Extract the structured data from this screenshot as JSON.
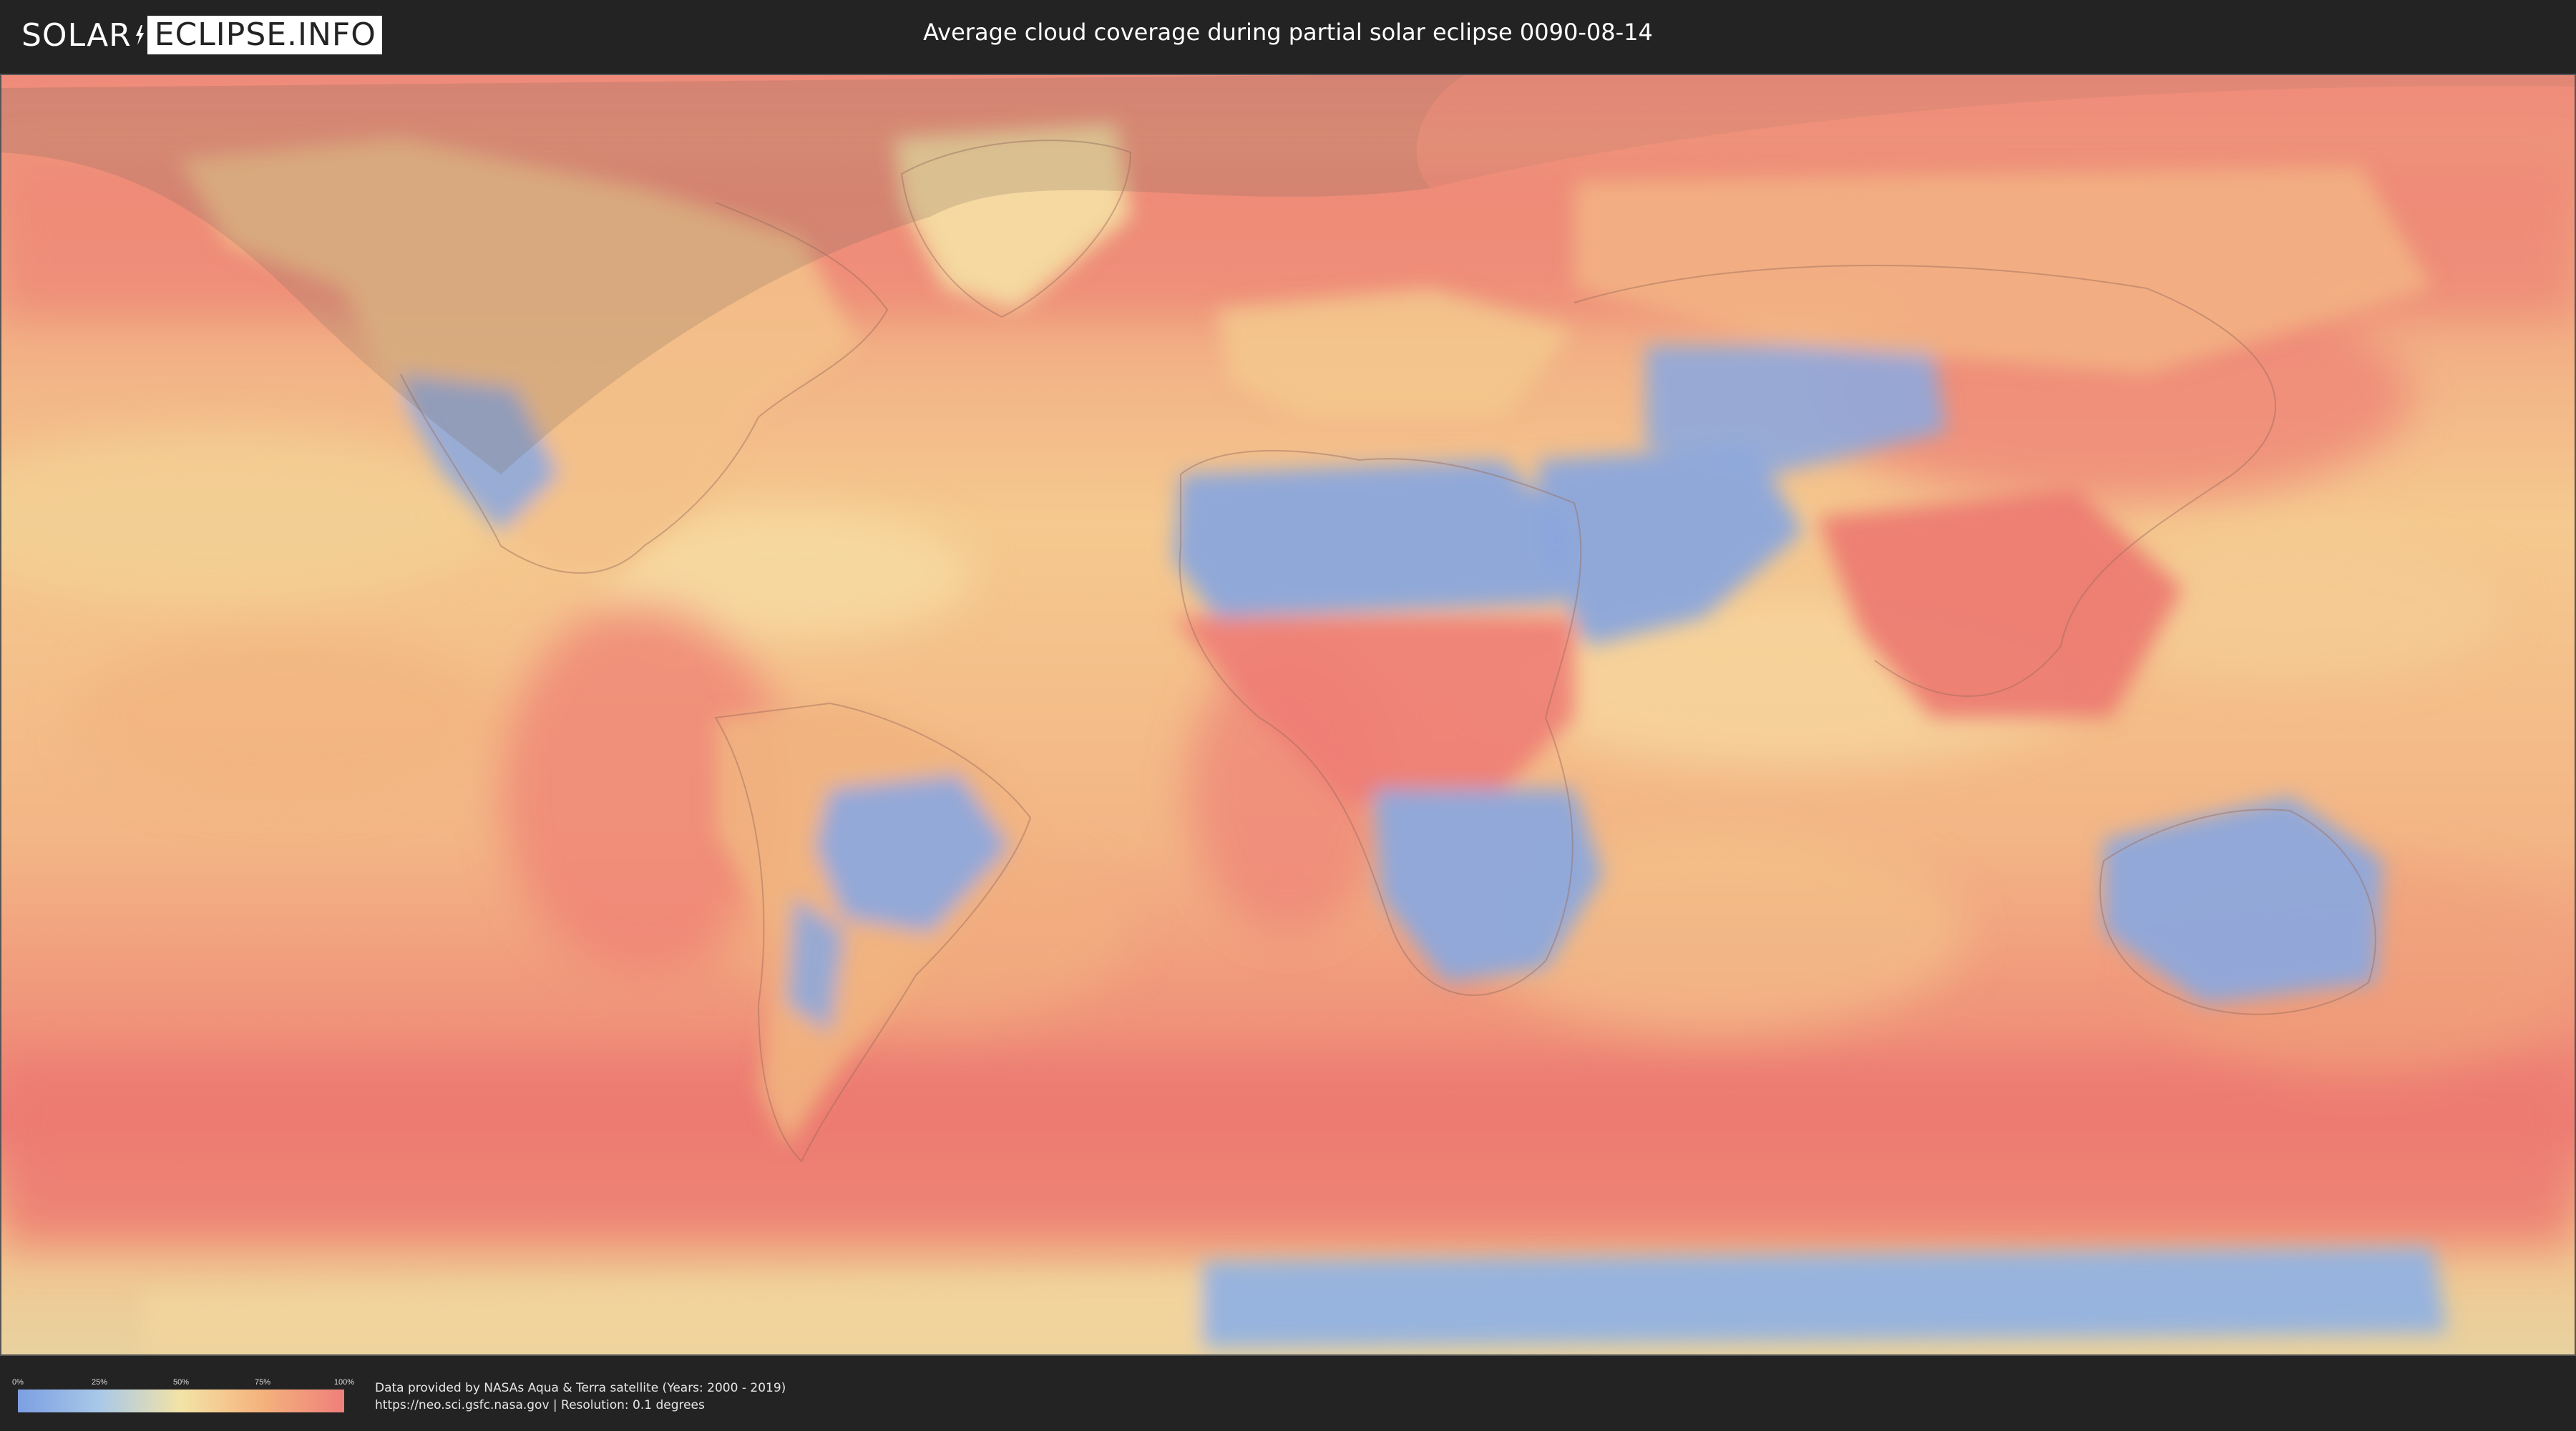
{
  "header": {
    "logo_left": "SOLAR",
    "logo_right": "ECLIPSE.INFO",
    "title": "Average cloud coverage during partial solar eclipse 0090-08-14"
  },
  "legend": {
    "ticks": [
      "0%",
      "25%",
      "50%",
      "75%",
      "100%"
    ],
    "tick_values": [
      0,
      25,
      50,
      75,
      100
    ],
    "colors": [
      "#7c9fe2",
      "#a9c8e8",
      "#f3e3a6",
      "#f4b27c",
      "#ef7f7b"
    ]
  },
  "footer": {
    "credit_line1": "Data provided by NASAs Aqua & Terra satellite (Years: 2000 - 2019)",
    "credit_line2": "https://neo.sci.gsfc.nasa.gov | Resolution: 0.1 degrees"
  },
  "map": {
    "projection": "equirectangular",
    "colors": {
      "ocean_mid": "#f3c58a",
      "cloudy": "#ef8077",
      "clear": "#8ea8dd",
      "eclipse_shade": "#7a6a5a"
    }
  }
}
